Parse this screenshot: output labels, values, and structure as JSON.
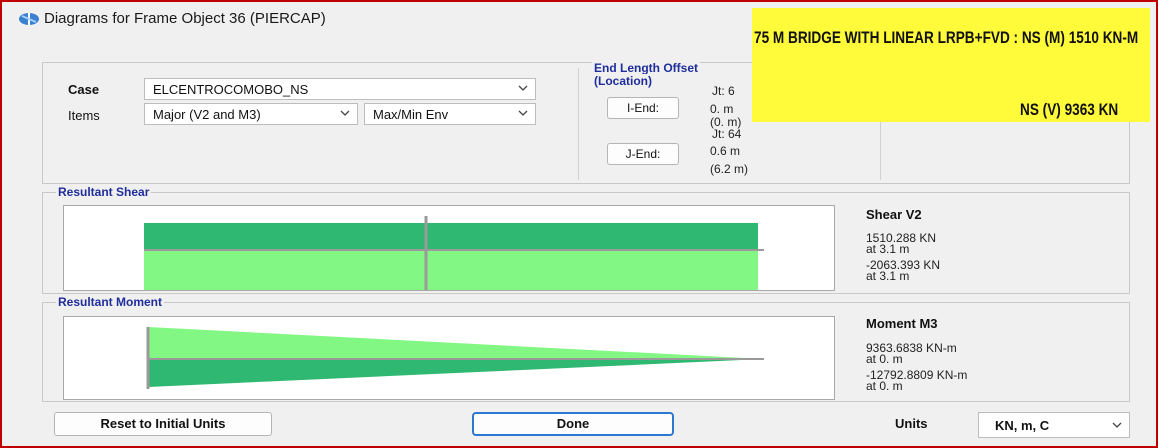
{
  "window": {
    "title": "Diagrams for Frame Object 36  (PIERCAP)"
  },
  "case": {
    "label": "Case",
    "value": "ELCENTROCOMOBO_NS"
  },
  "items": {
    "label": "Items",
    "value": "Major (V2 and M3)",
    "envelope": "Max/Min Env"
  },
  "end_length": {
    "title_line1": "End Length Offset",
    "title_line2": "(Location)",
    "i_end_button": "I-End:",
    "i_jt": "Jt: 6",
    "i_len": "0. m",
    "i_loc": "(0. m)",
    "j_end_button": "J-End:",
    "j_jt": "Jt: 64",
    "j_len": "0.6 m",
    "j_loc": "(6.2 m)"
  },
  "banner": {
    "line1": "75 M BRIDGE WITH LINEAR LRPB+FVD  : NS  (M)     1510 KN-M",
    "line2": "NS   (V)     9363 KN"
  },
  "shear": {
    "group_title": "Resultant Shear",
    "readout_title": "Shear V2",
    "max_value": "1510.288 KN",
    "max_at": "at 3.1 m",
    "min_value": "-2063.393 KN",
    "min_at": "at 3.1 m",
    "max_kn": 1510.288,
    "min_kn": -2063.393
  },
  "moment": {
    "group_title": "Resultant Moment",
    "readout_title": "Moment M3",
    "max_value": "9363.6838 KN-m",
    "max_at": "at 0. m",
    "min_value": "-12792.8809 KN-m",
    "min_at": "at 0. m"
  },
  "footer": {
    "reset_label": "Reset to Initial Units",
    "done_label": "Done",
    "units_label": "Units",
    "units_value": "KN, m, C"
  },
  "colors": {
    "positive_fill": "#2fb872",
    "negative_fill": "#82f783",
    "axis": "#9a9a9a",
    "frame_border": "#c00000",
    "banner": "#fffb3a"
  }
}
